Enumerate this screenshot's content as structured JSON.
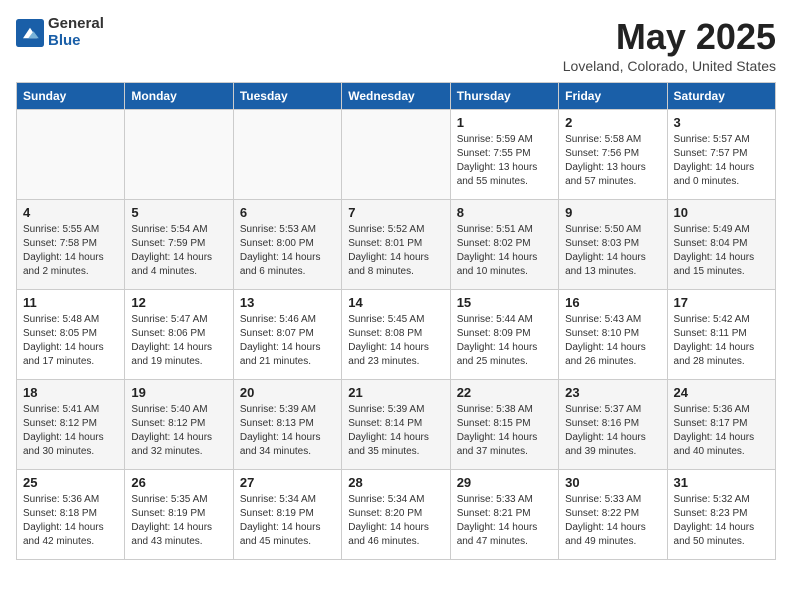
{
  "logo": {
    "general": "General",
    "blue": "Blue"
  },
  "title": "May 2025",
  "subtitle": "Loveland, Colorado, United States",
  "days_of_week": [
    "Sunday",
    "Monday",
    "Tuesday",
    "Wednesday",
    "Thursday",
    "Friday",
    "Saturday"
  ],
  "weeks": [
    [
      {
        "day": "",
        "info": ""
      },
      {
        "day": "",
        "info": ""
      },
      {
        "day": "",
        "info": ""
      },
      {
        "day": "",
        "info": ""
      },
      {
        "day": "1",
        "info": "Sunrise: 5:59 AM\nSunset: 7:55 PM\nDaylight: 13 hours\nand 55 minutes."
      },
      {
        "day": "2",
        "info": "Sunrise: 5:58 AM\nSunset: 7:56 PM\nDaylight: 13 hours\nand 57 minutes."
      },
      {
        "day": "3",
        "info": "Sunrise: 5:57 AM\nSunset: 7:57 PM\nDaylight: 14 hours\nand 0 minutes."
      }
    ],
    [
      {
        "day": "4",
        "info": "Sunrise: 5:55 AM\nSunset: 7:58 PM\nDaylight: 14 hours\nand 2 minutes."
      },
      {
        "day": "5",
        "info": "Sunrise: 5:54 AM\nSunset: 7:59 PM\nDaylight: 14 hours\nand 4 minutes."
      },
      {
        "day": "6",
        "info": "Sunrise: 5:53 AM\nSunset: 8:00 PM\nDaylight: 14 hours\nand 6 minutes."
      },
      {
        "day": "7",
        "info": "Sunrise: 5:52 AM\nSunset: 8:01 PM\nDaylight: 14 hours\nand 8 minutes."
      },
      {
        "day": "8",
        "info": "Sunrise: 5:51 AM\nSunset: 8:02 PM\nDaylight: 14 hours\nand 10 minutes."
      },
      {
        "day": "9",
        "info": "Sunrise: 5:50 AM\nSunset: 8:03 PM\nDaylight: 14 hours\nand 13 minutes."
      },
      {
        "day": "10",
        "info": "Sunrise: 5:49 AM\nSunset: 8:04 PM\nDaylight: 14 hours\nand 15 minutes."
      }
    ],
    [
      {
        "day": "11",
        "info": "Sunrise: 5:48 AM\nSunset: 8:05 PM\nDaylight: 14 hours\nand 17 minutes."
      },
      {
        "day": "12",
        "info": "Sunrise: 5:47 AM\nSunset: 8:06 PM\nDaylight: 14 hours\nand 19 minutes."
      },
      {
        "day": "13",
        "info": "Sunrise: 5:46 AM\nSunset: 8:07 PM\nDaylight: 14 hours\nand 21 minutes."
      },
      {
        "day": "14",
        "info": "Sunrise: 5:45 AM\nSunset: 8:08 PM\nDaylight: 14 hours\nand 23 minutes."
      },
      {
        "day": "15",
        "info": "Sunrise: 5:44 AM\nSunset: 8:09 PM\nDaylight: 14 hours\nand 25 minutes."
      },
      {
        "day": "16",
        "info": "Sunrise: 5:43 AM\nSunset: 8:10 PM\nDaylight: 14 hours\nand 26 minutes."
      },
      {
        "day": "17",
        "info": "Sunrise: 5:42 AM\nSunset: 8:11 PM\nDaylight: 14 hours\nand 28 minutes."
      }
    ],
    [
      {
        "day": "18",
        "info": "Sunrise: 5:41 AM\nSunset: 8:12 PM\nDaylight: 14 hours\nand 30 minutes."
      },
      {
        "day": "19",
        "info": "Sunrise: 5:40 AM\nSunset: 8:12 PM\nDaylight: 14 hours\nand 32 minutes."
      },
      {
        "day": "20",
        "info": "Sunrise: 5:39 AM\nSunset: 8:13 PM\nDaylight: 14 hours\nand 34 minutes."
      },
      {
        "day": "21",
        "info": "Sunrise: 5:39 AM\nSunset: 8:14 PM\nDaylight: 14 hours\nand 35 minutes."
      },
      {
        "day": "22",
        "info": "Sunrise: 5:38 AM\nSunset: 8:15 PM\nDaylight: 14 hours\nand 37 minutes."
      },
      {
        "day": "23",
        "info": "Sunrise: 5:37 AM\nSunset: 8:16 PM\nDaylight: 14 hours\nand 39 minutes."
      },
      {
        "day": "24",
        "info": "Sunrise: 5:36 AM\nSunset: 8:17 PM\nDaylight: 14 hours\nand 40 minutes."
      }
    ],
    [
      {
        "day": "25",
        "info": "Sunrise: 5:36 AM\nSunset: 8:18 PM\nDaylight: 14 hours\nand 42 minutes."
      },
      {
        "day": "26",
        "info": "Sunrise: 5:35 AM\nSunset: 8:19 PM\nDaylight: 14 hours\nand 43 minutes."
      },
      {
        "day": "27",
        "info": "Sunrise: 5:34 AM\nSunset: 8:19 PM\nDaylight: 14 hours\nand 45 minutes."
      },
      {
        "day": "28",
        "info": "Sunrise: 5:34 AM\nSunset: 8:20 PM\nDaylight: 14 hours\nand 46 minutes."
      },
      {
        "day": "29",
        "info": "Sunrise: 5:33 AM\nSunset: 8:21 PM\nDaylight: 14 hours\nand 47 minutes."
      },
      {
        "day": "30",
        "info": "Sunrise: 5:33 AM\nSunset: 8:22 PM\nDaylight: 14 hours\nand 49 minutes."
      },
      {
        "day": "31",
        "info": "Sunrise: 5:32 AM\nSunset: 8:23 PM\nDaylight: 14 hours\nand 50 minutes."
      }
    ]
  ]
}
